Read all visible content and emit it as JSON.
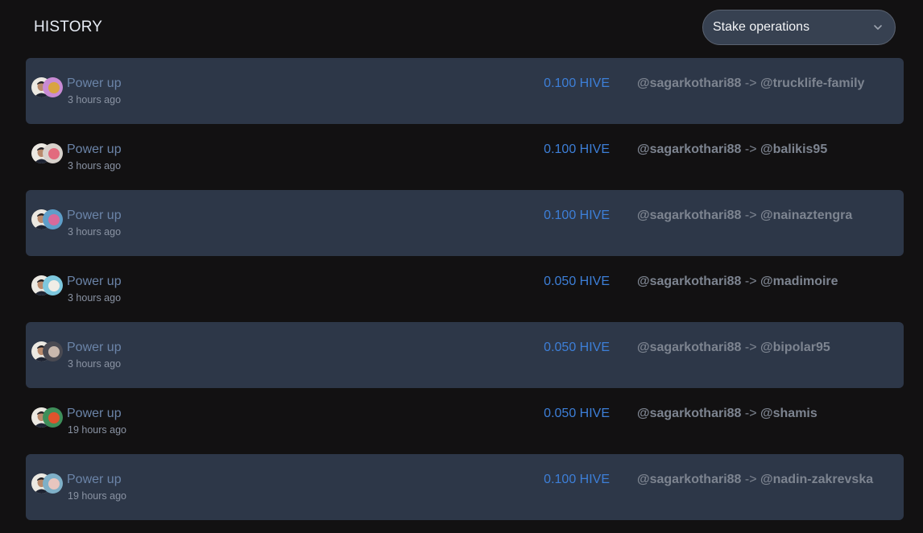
{
  "header": {
    "title": "HISTORY",
    "filter": {
      "selected": "Stake operations",
      "icon": "chevron-down-icon"
    }
  },
  "colors": {
    "page_bg": "#121112",
    "row_shaded_bg": "#2d3748",
    "operation_text": "#6b84a8",
    "amount_text": "#3d7fd8",
    "account_text": "#7d8490"
  },
  "history": [
    {
      "operation": "Power up",
      "time": "3 hours ago",
      "amount": "0.100 HIVE",
      "from": "@sagarkothari88",
      "arrow": "->",
      "to": "@trucklife-family",
      "to_avatar_colors": [
        "#c98bd4",
        "#d9a441"
      ]
    },
    {
      "operation": "Power up",
      "time": "3 hours ago",
      "amount": "0.100 HIVE",
      "from": "@sagarkothari88",
      "arrow": "->",
      "to": "@balikis95",
      "to_avatar_colors": [
        "#d8d2cc",
        "#e26b7e"
      ]
    },
    {
      "operation": "Power up",
      "time": "3 hours ago",
      "amount": "0.100 HIVE",
      "from": "@sagarkothari88",
      "arrow": "->",
      "to": "@nainaztengra",
      "to_avatar_colors": [
        "#5f9ec9",
        "#d86a9b"
      ]
    },
    {
      "operation": "Power up",
      "time": "3 hours ago",
      "amount": "0.050 HIVE",
      "from": "@sagarkothari88",
      "arrow": "->",
      "to": "@madimoire",
      "to_avatar_colors": [
        "#7ec8de",
        "#f0ede6"
      ]
    },
    {
      "operation": "Power up",
      "time": "3 hours ago",
      "amount": "0.050 HIVE",
      "from": "@sagarkothari88",
      "arrow": "->",
      "to": "@bipolar95",
      "to_avatar_colors": [
        "#4a4a52",
        "#c9b8ad"
      ]
    },
    {
      "operation": "Power up",
      "time": "19 hours ago",
      "amount": "0.050 HIVE",
      "from": "@sagarkothari88",
      "arrow": "->",
      "to": "@shamis",
      "to_avatar_colors": [
        "#3f8f5a",
        "#e0532d"
      ]
    },
    {
      "operation": "Power up",
      "time": "19 hours ago",
      "amount": "0.100 HIVE",
      "from": "@sagarkothari88",
      "arrow": "->",
      "to": "@nadin-zakrevska",
      "to_avatar_colors": [
        "#7fb0c8",
        "#e8c6bf"
      ]
    }
  ]
}
